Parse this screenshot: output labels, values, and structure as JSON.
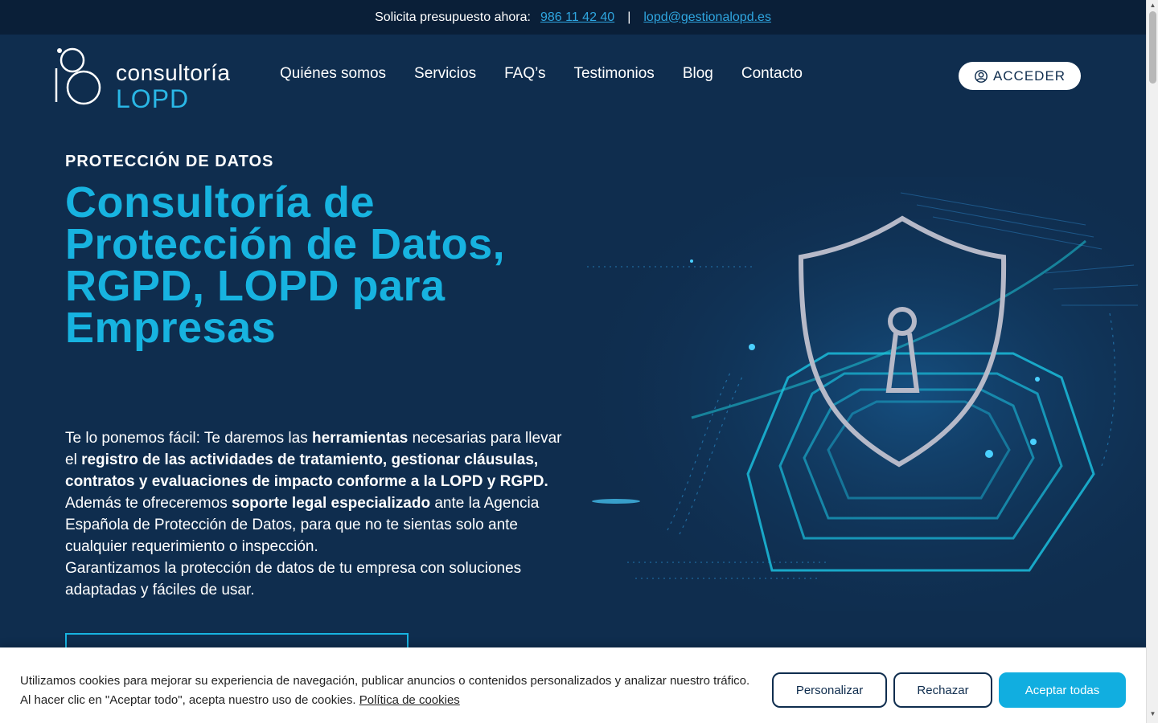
{
  "topbar": {
    "prompt": "Solicita presupuesto ahora:",
    "phone": "986 11 42 40",
    "separator": "|",
    "email": "lopd@gestionalopd.es"
  },
  "logo": {
    "line1": "consultoría",
    "line2": "LOPD"
  },
  "nav": {
    "items": [
      "Quiénes somos",
      "Servicios",
      "FAQ’s",
      "Testimonios",
      "Blog",
      "Contacto"
    ]
  },
  "acceder_label": "ACCEDER",
  "hero": {
    "eyebrow": "PROTECCIÓN DE DATOS",
    "title": "Consultoría de Protección de Datos, RGPD, LOPD para Empresas",
    "p1_a": "Te lo ponemos fácil: Te daremos las ",
    "p1_b": "herramientas",
    "p1_c": " necesarias para llevar el ",
    "p1_d": "registro de las actividades de tratamiento, gestionar cláusulas, contratos y evaluaciones de impacto conforme a la LOPD y RGPD.",
    "p1_e": " Además te ofreceremos ",
    "p1_f": "soporte legal especializado",
    "p1_g": " ante la Agencia Española de Protección de Datos, para que no te sientas solo ante cualquier requerimiento o inspección.",
    "p2": "Garantizamos la protección de datos de tu empresa con soluciones adaptadas y fáciles de usar."
  },
  "cookie": {
    "text": "Utilizamos cookies para mejorar su experiencia de navegación, publicar anuncios o contenidos personalizados y analizar nuestro tráfico. Al hacer clic en \"Aceptar todo\", acepta nuestro uso de cookies. ",
    "policy_link": "Política de cookies",
    "personalize": "Personalizar",
    "reject": "Rechazar",
    "accept_all": "Aceptar todas"
  },
  "colors": {
    "background": "#0f2d4e",
    "topbar": "#0a1f38",
    "accent": "#17b3e0",
    "link": "#2fa6e0"
  },
  "icons": [
    "logo-mark-icon",
    "user-circle-icon",
    "shield-lock-icon"
  ]
}
